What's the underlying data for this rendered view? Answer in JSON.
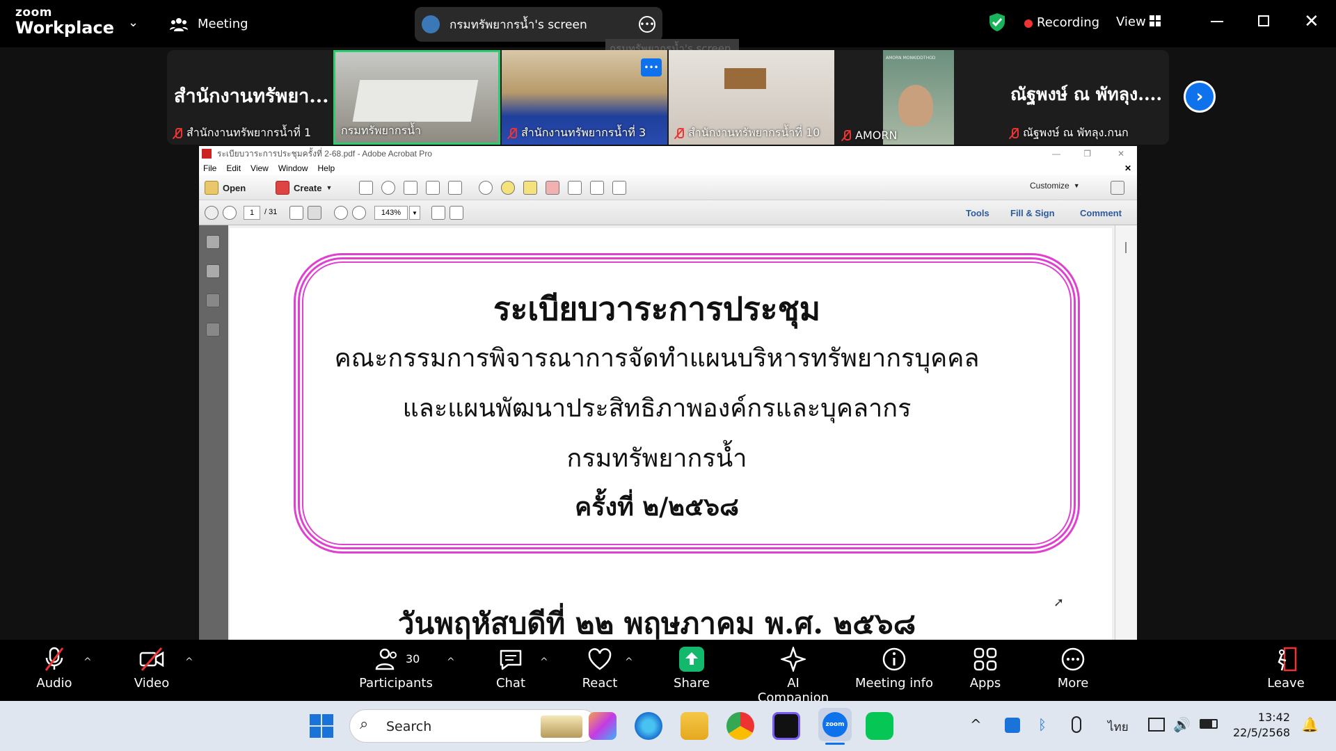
{
  "app": {
    "brand_top": "zoom",
    "brand_bottom": "Workplace"
  },
  "topbar": {
    "meeting_label": "Meeting",
    "share_title": "กรมทรัพยากรน้ำ's screen",
    "tooltip": "กรมทรัพยากรน้ำ's screen",
    "recording_label": "Recording",
    "view_label": "View"
  },
  "gallery": {
    "tiles": [
      {
        "big": "สำนักงานทรัพยา...",
        "name": "สำนักงานทรัพยากรน้ำที่ 1"
      },
      {
        "big": "",
        "name": "กรมทรัพยากรน้ำ"
      },
      {
        "big": "",
        "name": "สำนักงานทรัพยากรน้ำที่ 3"
      },
      {
        "big": "",
        "name": "สำนักงานทรัพยากรน้ำที่ 10"
      },
      {
        "big": "",
        "name": "AMORN"
      },
      {
        "big": "ณัฐพงษ์ ณ พัทลุง....",
        "name": "ณัฐพงษ์ ณ พัทลุง.กนก"
      }
    ],
    "amorn_caption": "AMORN MONKIDDTHOD"
  },
  "acrobat": {
    "title": "ระเบียบวาระการประชุมครั้งที่ 2-68.pdf - Adobe Acrobat Pro",
    "menu": [
      "File",
      "Edit",
      "View",
      "Window",
      "Help"
    ],
    "open_label": "Open",
    "create_label": "Create",
    "customize_label": "Customize",
    "page_current": "1",
    "page_total": "/ 31",
    "zoom": "143%",
    "tools_label": "Tools",
    "fill_sign_label": "Fill & Sign",
    "comment_label": "Comment"
  },
  "document": {
    "line1": "ระเบียบวาระการประชุม",
    "line2": "คณะกรรมการพิจารณาการจัดทำแผนบริหารทรัพยากรบุคคล",
    "line3": "และแผนพัฒนาประสิทธิภาพองค์กรและบุคลากร",
    "line4": "กรมทรัพยากรน้ำ",
    "line5": "ครั้งที่ ๒/๒๕๖๘",
    "date": "วันพฤหัสบดีที่ ๒๒ พฤษภาคม พ.ศ. ๒๕๖๘"
  },
  "controls": {
    "audio": "Audio",
    "video": "Video",
    "participants": "Participants",
    "participants_count": "30",
    "chat": "Chat",
    "react": "React",
    "share": "Share",
    "ai": "AI Companion",
    "info": "Meeting info",
    "apps": "Apps",
    "more": "More",
    "leave": "Leave"
  },
  "taskbar": {
    "search_placeholder": "Search",
    "lang": "ไทย",
    "time": "13:42",
    "date": "22/5/2568"
  },
  "colors": {
    "zoom_blue": "#0e72ed",
    "share_green": "#12b86b",
    "frame_pink": "#e040d0",
    "active_tile": "#2ecc71",
    "recording_red": "#e33"
  }
}
